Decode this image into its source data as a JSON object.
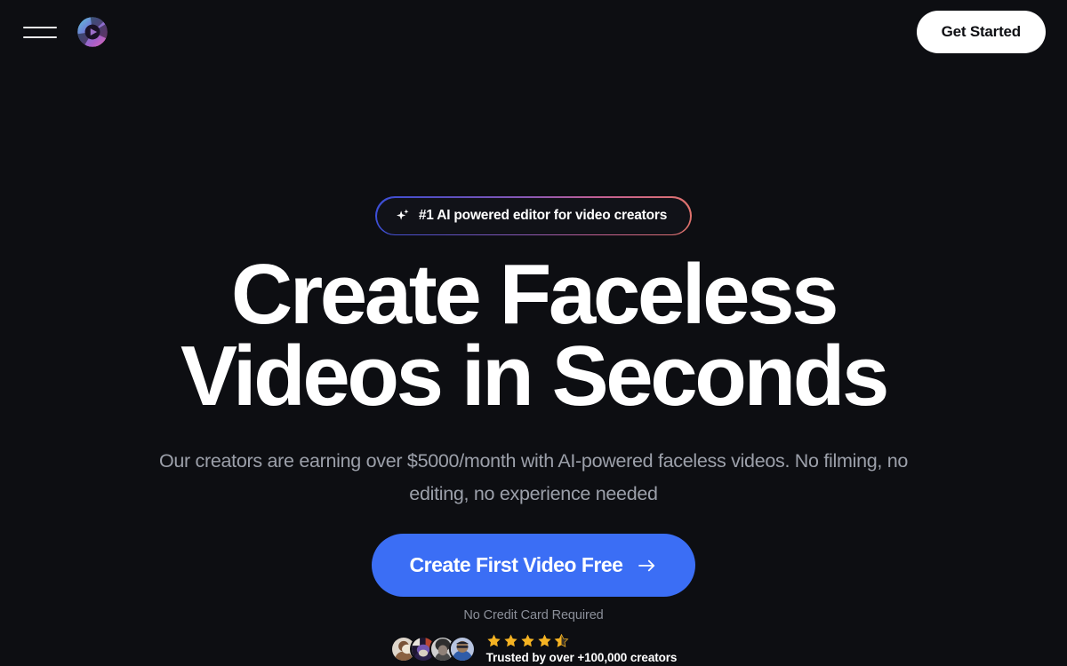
{
  "colors": {
    "background": "#0d0e12",
    "accent_blue": "#3b6ef5",
    "badge_gradient_start": "#3b4fd8",
    "badge_gradient_end": "#e0736c",
    "star_gold": "#f5b323",
    "muted_text": "#9ca0aa",
    "white": "#ffffff"
  },
  "header": {
    "menu_icon": "hamburger-menu-icon",
    "logo_icon": "aperture-play-logo",
    "get_started_label": "Get Started"
  },
  "hero": {
    "badge": {
      "icon": "sparkle-icon",
      "text": "#1 AI powered editor for video creators"
    },
    "headline_lines": [
      "Create Faceless",
      "Videos in Seconds"
    ],
    "subtitle": "Our creators are earning over $5000/month with AI-powered faceless videos. No filming, no editing, no experience needed",
    "cta": {
      "label": "Create First Video Free",
      "icon": "arrow-right-icon"
    },
    "fineprint": "No Credit Card Required",
    "social_proof": {
      "avatar_count": 4,
      "avatars": [
        {
          "name": "creator-avatar-1",
          "tone": "#c9a079",
          "bg": "#e8e2da"
        },
        {
          "name": "creator-avatar-2",
          "tone": "#7b5fa8",
          "bg": "#b44a3c"
        },
        {
          "name": "creator-avatar-3",
          "tone": "#8e8e8e",
          "bg": "#d8d8d8"
        },
        {
          "name": "creator-avatar-4",
          "tone": "#3a63b8",
          "bg": "#c3cde4"
        }
      ],
      "rating_value": 4.5,
      "rating_max": 5,
      "stars_full": 4,
      "stars_half": 1,
      "trust_text": "Trusted by over +100,000 creators"
    }
  }
}
